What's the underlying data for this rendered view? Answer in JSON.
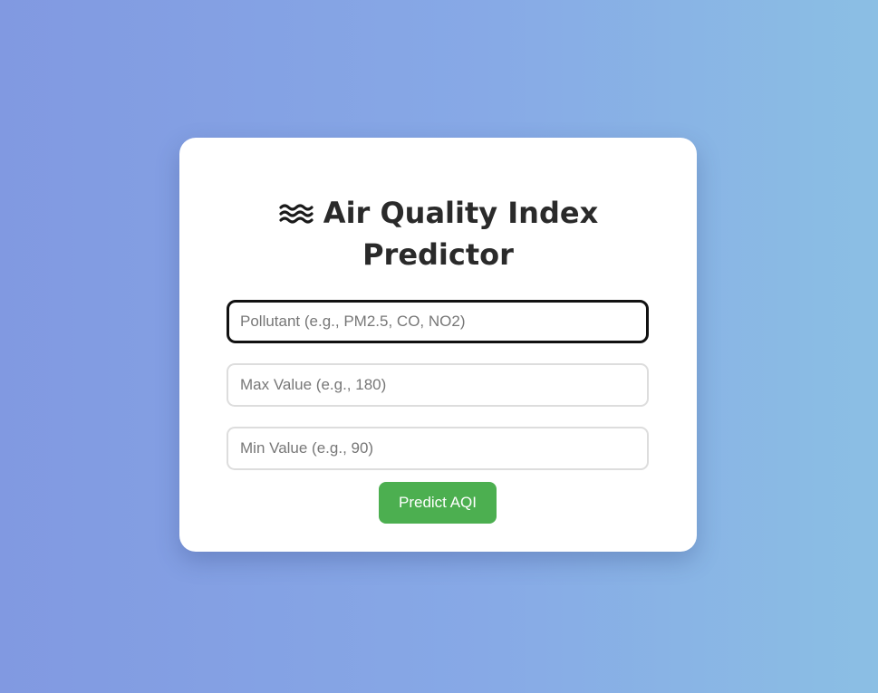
{
  "card": {
    "title_line1": "Air Quality Index",
    "title_line2": "Predictor",
    "title_icon": "wave-icon"
  },
  "form": {
    "pollutant": {
      "placeholder": "Pollutant (e.g., PM2.5, CO, NO2)",
      "value": ""
    },
    "max_value": {
      "placeholder": "Max Value (e.g., 180)",
      "value": ""
    },
    "min_value": {
      "placeholder": "Min Value (e.g., 90)",
      "value": ""
    },
    "submit_label": "Predict AQI"
  },
  "colors": {
    "background_start": "#8199e1",
    "background_end": "#8bbfe4",
    "button": "#4caf50",
    "focus_border": "#111111"
  }
}
